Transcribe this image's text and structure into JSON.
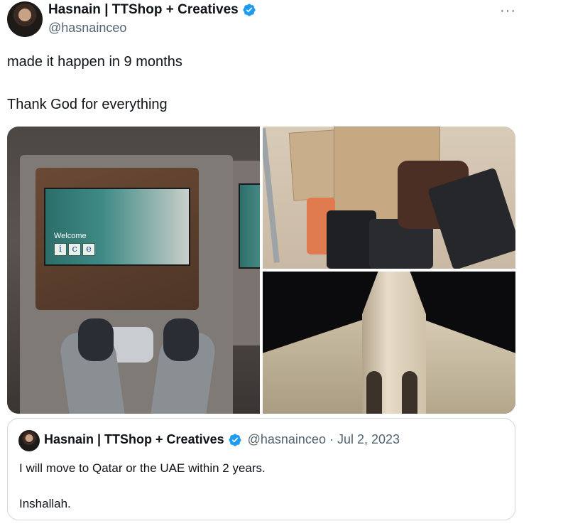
{
  "tweet": {
    "display_name": "Hasnain | TTShop + Creatives",
    "handle": "@hasnainceo",
    "more_label": "···",
    "text_line1": "made it happen in 9 months",
    "text_line2": "Thank God for everything"
  },
  "media": {
    "photo1": {
      "welcome": "Welcome",
      "ice": [
        "i",
        "c",
        "e"
      ]
    }
  },
  "quote": {
    "display_name": "Hasnain | TTShop + Creatives",
    "handle": "@hasnainceo",
    "separator": "·",
    "date": "Jul 2, 2023",
    "text_line1": "I will move to Qatar or the UAE within 2 years.",
    "text_line2": "Inshallah."
  },
  "colors": {
    "verified": "#1d9bf0",
    "text": "#0f1419",
    "secondary": "#536471",
    "border": "#cfd9de"
  },
  "icons": {
    "verified": "verified-badge-icon",
    "more": "more-options-icon"
  }
}
